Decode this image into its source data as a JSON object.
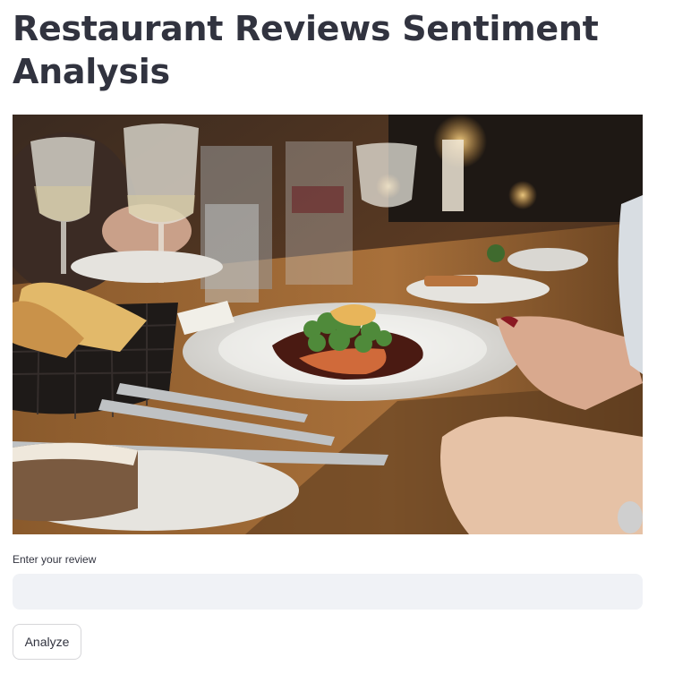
{
  "header": {
    "title": "Restaurant Reviews Sentiment Analysis"
  },
  "hero_image": {
    "description_icon": "restaurant-dinner-photo"
  },
  "review_form": {
    "label": "Enter your review",
    "input_value": "",
    "analyze_label": "Analyze"
  },
  "colors": {
    "text": "#31333f",
    "input_bg": "#f0f2f6",
    "button_border": "#d6d6d9"
  }
}
